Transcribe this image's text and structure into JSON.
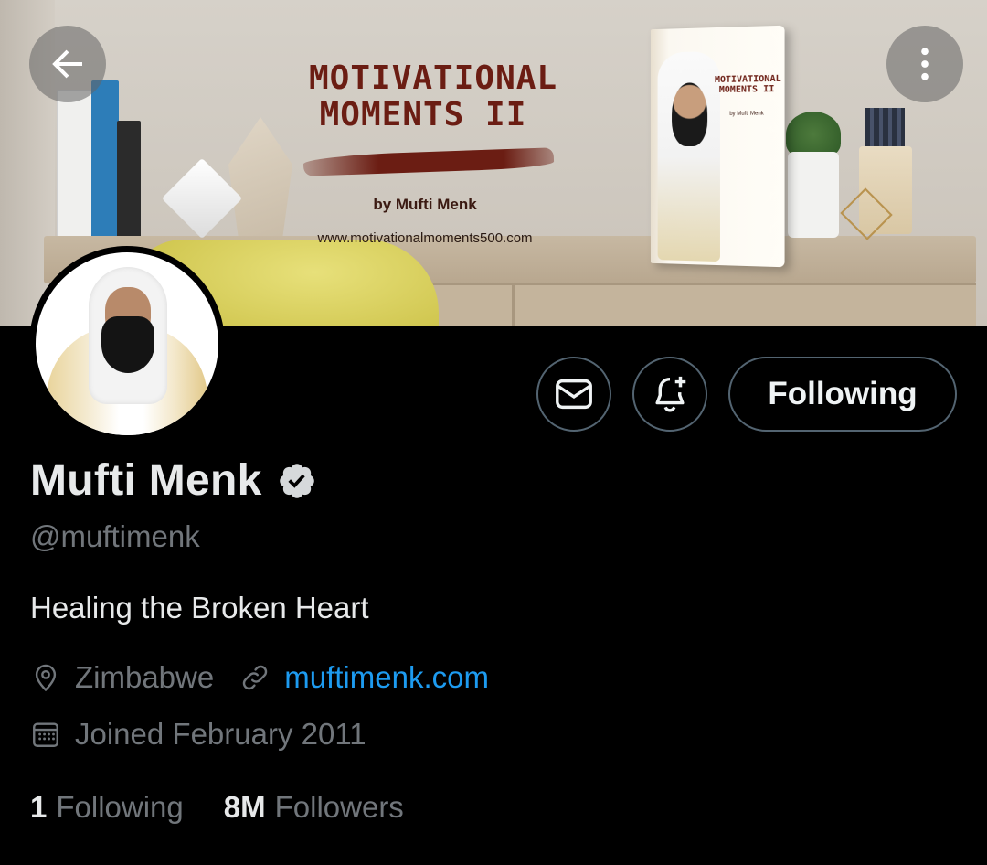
{
  "banner": {
    "promo_title": "MOTIVATIONAL MOMENTS II",
    "promo_byline": "by Mufti Menk",
    "promo_url": "www.motivationalmoments500.com",
    "book_cover_title": "MOTIVATIONAL MOMENTS II",
    "book_cover_byline": "by Mufti Menk"
  },
  "nav": {
    "back_icon": "arrow-left-icon",
    "more_icon": "more-vertical-icon"
  },
  "actions": {
    "message_icon": "envelope-icon",
    "notify_icon": "bell-plus-icon",
    "follow_label": "Following"
  },
  "profile": {
    "name": "Mufti Menk",
    "verified": true,
    "handle": "@muftimenk",
    "bio": "Healing the Broken Heart",
    "location": "Zimbabwe",
    "website": "muftimenk.com",
    "joined": "Joined February 2011"
  },
  "stats": {
    "following_count": "1",
    "following_label": "Following",
    "followers_count": "8M",
    "followers_label": "Followers"
  },
  "colors": {
    "background": "#000000",
    "link": "#1d9bf0",
    "muted_text": "#71767b",
    "primary_text": "#e7e9ea",
    "button_border": "#536471"
  }
}
